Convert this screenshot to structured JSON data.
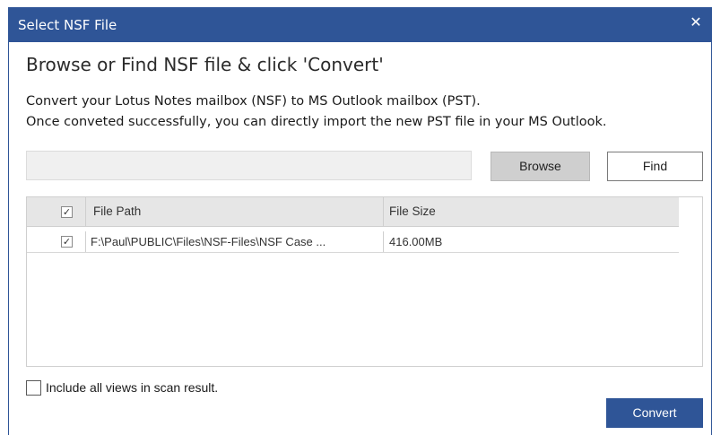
{
  "window": {
    "title": "Select NSF File",
    "close_glyph": "✕"
  },
  "heading": "Browse or Find NSF file & click 'Convert'",
  "description": {
    "line1": "Convert your Lotus Notes mailbox (NSF) to MS Outlook mailbox (PST).",
    "line2": "Once conveted successfully, you can directly import the new PST file in your MS Outlook."
  },
  "path_input": {
    "value": "",
    "placeholder": ""
  },
  "buttons": {
    "browse": "Browse",
    "find": "Find",
    "convert": "Convert"
  },
  "file_list": {
    "columns": [
      "File Path",
      "File Size"
    ],
    "header_checked": true,
    "rows": [
      {
        "checked": true,
        "path": "F:\\Paul\\PUBLIC\\Files\\NSF-Files\\NSF Case ...",
        "size": "416.00MB"
      }
    ]
  },
  "options": {
    "include_views_label": "Include all views in scan result.",
    "include_views_checked": false
  },
  "colors": {
    "accent": "#2f5597",
    "header_bg": "#e6e6e6",
    "browse_bg": "#cfcfcf"
  },
  "icons": {
    "check_glyph": "✓"
  }
}
